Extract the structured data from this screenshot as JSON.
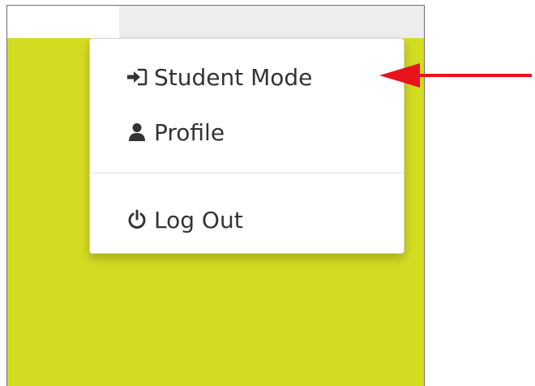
{
  "menu": {
    "items": [
      {
        "label": "Student Mode",
        "icon": "sign-in-icon"
      },
      {
        "label": "Profile",
        "icon": "user-icon"
      },
      {
        "label": "Log Out",
        "icon": "power-icon"
      }
    ]
  },
  "colors": {
    "background": "#d4dc22",
    "top_bar": "#ededed",
    "menu_text": "#333333",
    "annotation_arrow": "#e8141c"
  }
}
